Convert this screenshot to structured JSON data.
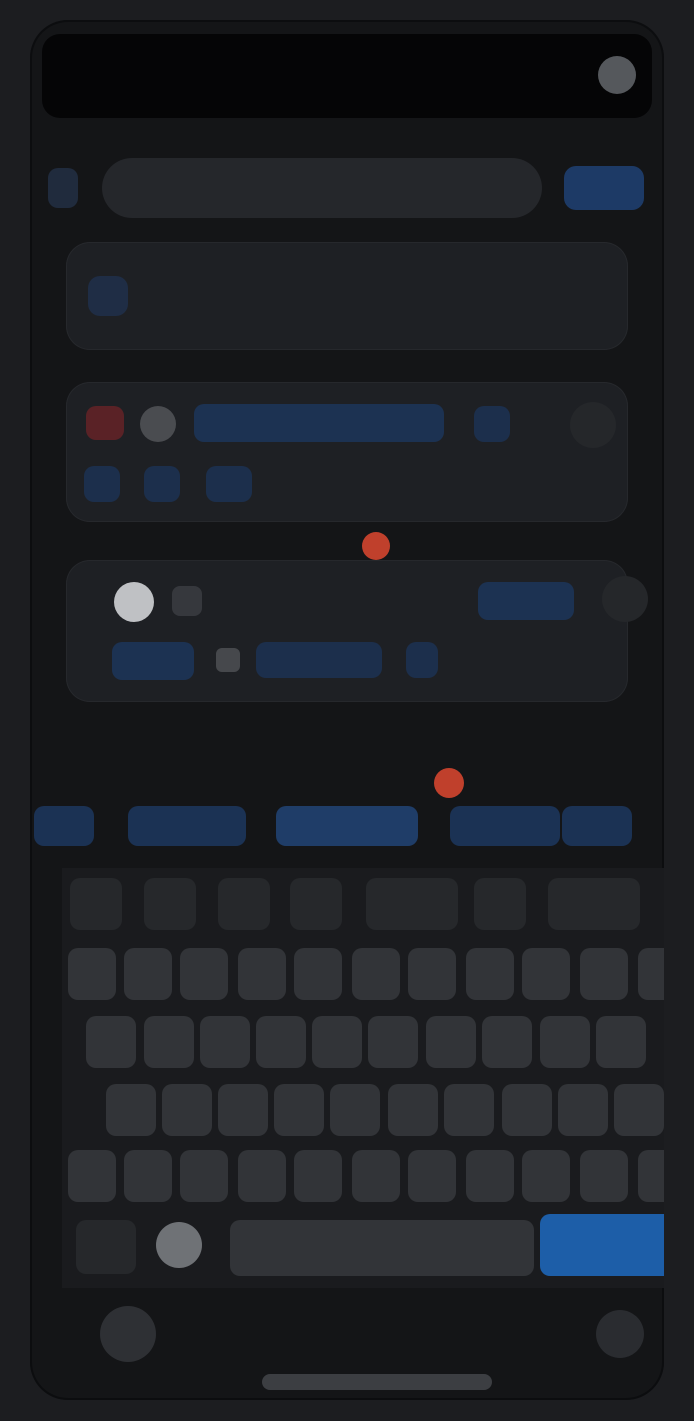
{
  "status": {
    "time": "",
    "right_text": ""
  },
  "address_bar": {
    "url": "",
    "go_label": ""
  },
  "search_card": {
    "query": ""
  },
  "card2": {
    "pill_label": ""
  },
  "card3": {
    "title": "",
    "pill_label": "",
    "link_label": ""
  },
  "keyboard_toolbar": {
    "field_label": "",
    "buttons": [
      "",
      "",
      "",
      "",
      ""
    ]
  },
  "keyboard": {
    "row0": [
      "",
      "",
      "",
      "",
      "",
      "",
      ""
    ],
    "row1": [
      "",
      "",
      "",
      "",
      "",
      "",
      "",
      "",
      "",
      "",
      ""
    ],
    "row2": [
      "",
      "",
      "",
      "",
      "",
      "",
      "",
      "",
      "",
      ""
    ],
    "row3": [
      "",
      "",
      "",
      "",
      "",
      "",
      "",
      "",
      "",
      ""
    ],
    "row4": [
      "",
      "",
      "",
      "",
      "",
      "",
      "",
      "",
      "",
      "",
      ""
    ],
    "space_label": "",
    "go_label": ""
  },
  "colors": {
    "accent": "#1d5ea8",
    "badge": "#c0402c",
    "background": "#141517"
  }
}
